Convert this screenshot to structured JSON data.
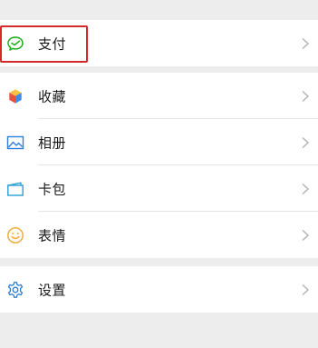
{
  "colors": {
    "background": "#ededed",
    "row_bg": "#ffffff",
    "highlight": "#d32b2b",
    "chevron": "#b2b2b2",
    "pay_icon": "#1aad19",
    "album_icon": "#2f7fd9",
    "card_icon": "#2a9fd6",
    "emoji_icon": "#f0a830",
    "settings_icon": "#2f7fd9"
  },
  "menu": {
    "pay": {
      "label": "支付",
      "icon": "pay-icon"
    },
    "favorites": {
      "label": "收藏",
      "icon": "cube-icon"
    },
    "album": {
      "label": "相册",
      "icon": "image-icon"
    },
    "cards": {
      "label": "卡包",
      "icon": "wallet-icon"
    },
    "stickers": {
      "label": "表情",
      "icon": "smiley-icon"
    },
    "settings": {
      "label": "设置",
      "icon": "gear-icon"
    }
  }
}
